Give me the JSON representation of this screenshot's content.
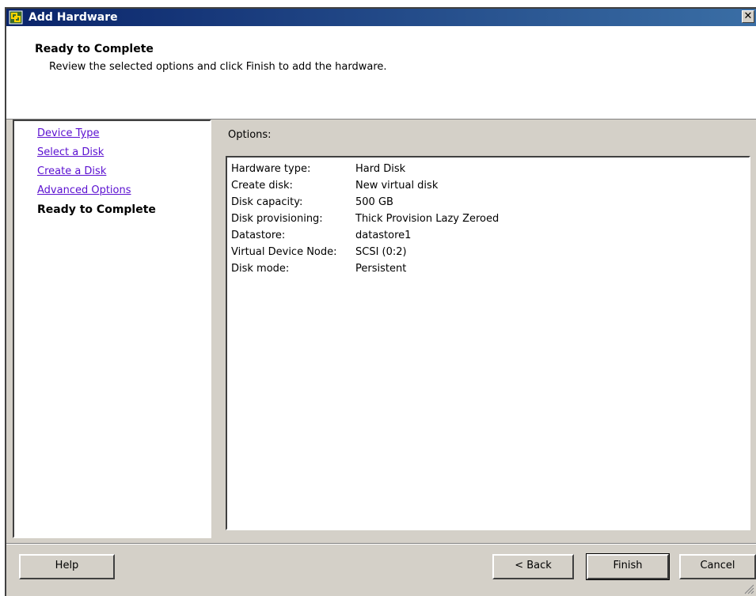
{
  "window": {
    "title": "Add Hardware",
    "close_glyph": "✕"
  },
  "header": {
    "title": "Ready to Complete",
    "subtitle": "Review the selected options and click Finish to add the hardware."
  },
  "nav": {
    "items": [
      {
        "label": "Device Type",
        "state": "link"
      },
      {
        "label": "Select a Disk",
        "state": "link"
      },
      {
        "label": "Create a Disk",
        "state": "link"
      },
      {
        "label": "Advanced Options",
        "state": "link"
      },
      {
        "label": "Ready to Complete",
        "state": "current"
      }
    ]
  },
  "options": {
    "label": "Options:",
    "rows": [
      {
        "key": "Hardware type:",
        "value": "Hard Disk"
      },
      {
        "key": "Create disk:",
        "value": "New virtual disk"
      },
      {
        "key": "Disk capacity:",
        "value": "500 GB"
      },
      {
        "key": "Disk provisioning:",
        "value": "Thick Provision Lazy Zeroed"
      },
      {
        "key": "Datastore:",
        "value": "datastore1"
      },
      {
        "key": "Virtual Device Node:",
        "value": "SCSI (0:2)"
      },
      {
        "key": "Disk mode:",
        "value": "Persistent"
      }
    ]
  },
  "buttons": {
    "help": "Help",
    "back": "< Back",
    "finish": "Finish",
    "cancel": "Cancel"
  },
  "colors": {
    "link": "#5a0fd0",
    "titlebar_start": "#0a246a",
    "titlebar_end": "#3a6ea5",
    "face": "#d4d0c8"
  },
  "icons": {
    "title": "vsphere-logo-icon",
    "close": "close-icon",
    "grip": "resize-grip-icon"
  }
}
